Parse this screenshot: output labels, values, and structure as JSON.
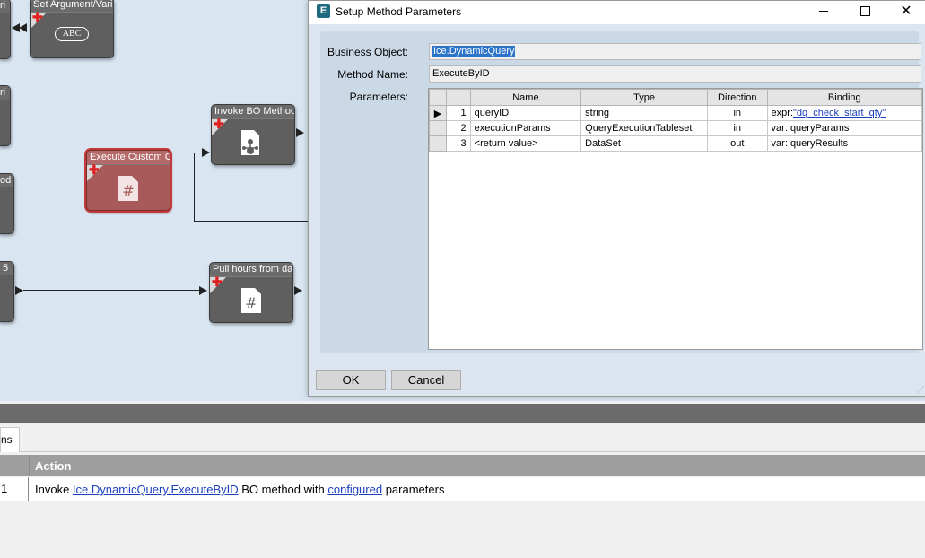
{
  "canvas": {
    "nodes": {
      "set_argument": {
        "title": "Set Argument/Vari",
        "badge": "ABC"
      },
      "invoke_bo": {
        "title": "Invoke BO Method"
      },
      "execute_custom": {
        "title": "Execute Custom Co"
      },
      "pull_hours": {
        "title": "Pull hours from da"
      }
    },
    "stubs": {
      "s1": "ri",
      "s2": "ri",
      "s3": "od",
      "s4": "5"
    }
  },
  "dialog": {
    "app_icon": "E",
    "title": "Setup Method Parameters",
    "labels": {
      "business_object": "Business Object:",
      "method_name": "Method Name:",
      "parameters": "Parameters:"
    },
    "business_object": "Ice.DynamicQuery",
    "method_name": "ExecuteByID",
    "columns": {
      "name": "Name",
      "type": "Type",
      "direction": "Direction",
      "binding": "Binding"
    },
    "rows": [
      {
        "num": "1",
        "name": "queryID",
        "type": "string",
        "direction": "in",
        "binding_prefix": "expr:",
        "binding_link": "\"dq_check_start_qty\""
      },
      {
        "num": "2",
        "name": "executionParams",
        "type": "QueryExecutionTableset",
        "direction": "in",
        "binding_prefix": "var: queryParams",
        "binding_link": ""
      },
      {
        "num": "3",
        "name": "<return value>",
        "type": "DataSet",
        "direction": "out",
        "binding_prefix": "var: queryResults",
        "binding_link": ""
      }
    ],
    "ok_label": "OK",
    "cancel_label": "Cancel"
  },
  "bottom": {
    "tab_label": "ns",
    "header_action": "Action",
    "row_num": "1",
    "action_prefix": "Invoke ",
    "action_link1": "Ice.DynamicQuery.ExecuteByID",
    "action_middle": " BO method with ",
    "action_link2": "configured",
    "action_suffix": " parameters"
  },
  "colors": {
    "canvas_bg": "#d9e6f2",
    "node_gray": "#5f5f5f",
    "node_error": "#a85a5a",
    "dialog_body": "#dbe4ef",
    "selection": "#2b74c8",
    "link": "#1a3fbf"
  }
}
